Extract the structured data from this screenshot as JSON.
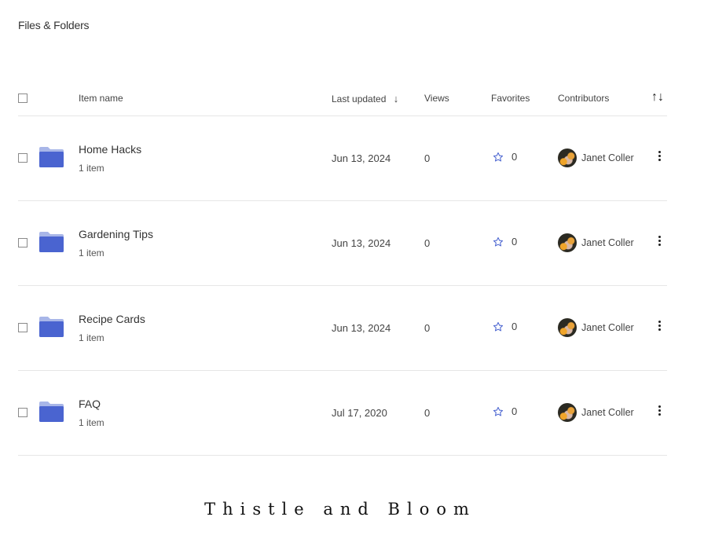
{
  "page": {
    "title": "Files & Folders"
  },
  "table": {
    "columns": {
      "name": "Item name",
      "last_updated": "Last updated",
      "last_updated_sort": "↓",
      "views": "Views",
      "favorites": "Favorites",
      "contributors": "Contributors",
      "sort_toggle": "↑↓"
    },
    "rows": [
      {
        "name": "Home Hacks",
        "count": "1 item",
        "date": "Jun 13, 2024",
        "views": "0",
        "favorites": "0",
        "contributor": "Janet Coller"
      },
      {
        "name": "Gardening Tips",
        "count": "1 item",
        "date": "Jun 13, 2024",
        "views": "0",
        "favorites": "0",
        "contributor": "Janet Coller"
      },
      {
        "name": "Recipe Cards",
        "count": "1 item",
        "date": "Jun 13, 2024",
        "views": "0",
        "favorites": "0",
        "contributor": "Janet Coller"
      },
      {
        "name": "FAQ",
        "count": "1 item",
        "date": "Jul 17, 2020",
        "views": "0",
        "favorites": "0",
        "contributor": "Janet Coller"
      }
    ]
  },
  "colors": {
    "folder": "#4a64d0",
    "folder_tab": "#a8b6e8",
    "star": "#4a64d0"
  },
  "footer": {
    "brand": "Thistle and Bloom"
  }
}
